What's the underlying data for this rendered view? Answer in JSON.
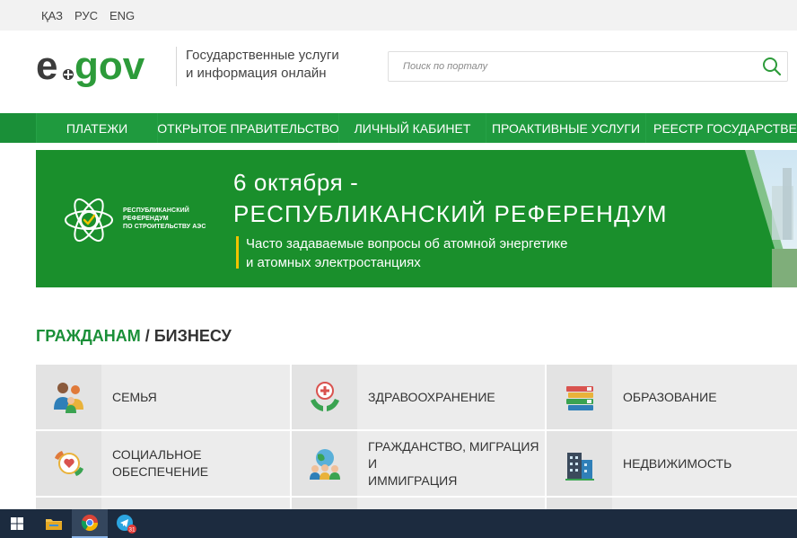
{
  "languages": [
    "ҚАЗ",
    "РУС",
    "ENG"
  ],
  "header": {
    "logo_text": "egov",
    "tagline_line1": "Государственные услуги",
    "tagline_line2": "и информация онлайн",
    "search_placeholder": "Поиск по порталу"
  },
  "nav": {
    "items": [
      "ПЛАТЕЖИ",
      "ОТКРЫТОЕ ПРАВИТЕЛЬСТВО",
      "ЛИЧНЫЙ КАБИНЕТ",
      "ПРОАКТИВНЫЕ УСЛУГИ",
      "РЕЕСТР ГОСУДАРСТВЕНН"
    ]
  },
  "banner": {
    "emblem_line1": "РЕСПУБЛИКАНСКИЙ",
    "emblem_line2": "РЕФЕРЕНДУМ",
    "emblem_line3": "ПО СТРОИТЕЛЬСТВУ АЭС",
    "date": "6 октября -",
    "headline": "РЕСПУБЛИКАНСКИЙ РЕФЕРЕНДУМ",
    "sub_line1": "Часто задаваемые вопросы об атомной энергетике",
    "sub_line2": "и атомных электростанциях"
  },
  "section": {
    "title_citizens": "ГРАЖДАНАМ",
    "separator": " / ",
    "title_business": "БИЗНЕСУ"
  },
  "tiles": [
    {
      "line1": "СЕМЬЯ",
      "line2": "",
      "icon": "family-icon"
    },
    {
      "line1": "ЗДРАВООХРАНЕНИЕ",
      "line2": "",
      "icon": "healthcare-icon"
    },
    {
      "line1": "ОБРАЗОВАНИЕ",
      "line2": "",
      "icon": "books-icon"
    },
    {
      "line1": "СОЦИАЛЬНОЕ",
      "line2": "ОБЕСПЕЧЕНИЕ",
      "icon": "social-care-icon"
    },
    {
      "line1": "ГРАЖДАНСТВО, МИГРАЦИЯ И",
      "line2": "ИММИГРАЦИЯ",
      "icon": "globe-people-icon"
    },
    {
      "line1": "НЕДВИЖИМОСТЬ",
      "line2": "",
      "icon": "building-icon"
    }
  ],
  "taskbar": {
    "telegram_badge": "31",
    "apps": [
      "windows-start-icon",
      "file-explorer-icon",
      "chrome-icon",
      "telegram-icon"
    ]
  },
  "colors": {
    "brand_green": "#1a8f38",
    "nav_green": "#1f9a3e",
    "banner_green": "#1a8f2c",
    "accent_yellow": "#f2c300",
    "tile_bg": "#ececec",
    "taskbar": "#1c2b3f"
  }
}
